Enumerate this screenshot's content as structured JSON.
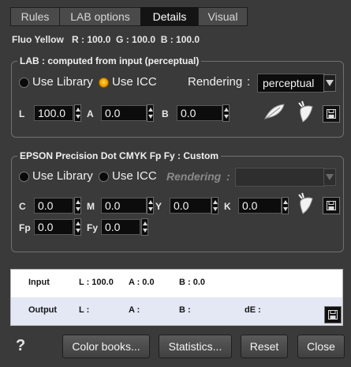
{
  "tabs": [
    {
      "label": "Rules",
      "active": false
    },
    {
      "label": "LAB options",
      "active": false
    },
    {
      "label": "Details",
      "active": true
    },
    {
      "label": "Visual",
      "active": false
    }
  ],
  "color_info": {
    "name": "Fluo Yellow",
    "rgb": "R : 100.0  G : 100.0  B : 100.0"
  },
  "lab_group": {
    "title": "LAB : computed from input (perceptual)",
    "use_library": "Use Library",
    "use_icc": "Use ICC",
    "selected": "use_icc",
    "rendering_label": "Rendering",
    "colon": ":",
    "rendering_value": "perceptual",
    "fields": [
      {
        "label": "L",
        "value": "100.0"
      },
      {
        "label": "A",
        "value": "0.0"
      },
      {
        "label": "B",
        "value": "0.0"
      }
    ]
  },
  "cmyk_group": {
    "title": "EPSON Precision Dot CMYK Fp Fy : Custom",
    "use_library": "Use Library",
    "use_icc": "Use ICC",
    "rendering_label": "Rendering",
    "colon": ":",
    "rendering_value": "",
    "fields": [
      {
        "label": "C",
        "value": "0.0"
      },
      {
        "label": "M",
        "value": "0.0"
      },
      {
        "label": "Y",
        "value": "0.0"
      },
      {
        "label": "K",
        "value": "0.0"
      },
      {
        "label": "Fp",
        "value": "0.0"
      },
      {
        "label": "Fy",
        "value": "0.0"
      }
    ]
  },
  "result_panel": {
    "input_label": "Input",
    "input_l": "L : 100.0",
    "input_a": "A : 0.0",
    "input_b": "B : 0.0",
    "output_label": "Output",
    "output_l": "L :",
    "output_a": "A :",
    "output_b": "B :",
    "output_de": "dE :"
  },
  "footer": {
    "help": "?",
    "color_books": "Color books...",
    "statistics": "Statistics...",
    "reset": "Reset",
    "close": "Close"
  },
  "colors": {
    "background": "#3a3a3a",
    "field": "#0c0c0c",
    "radio_on": "#f0a000",
    "active_tab": "#141414"
  }
}
